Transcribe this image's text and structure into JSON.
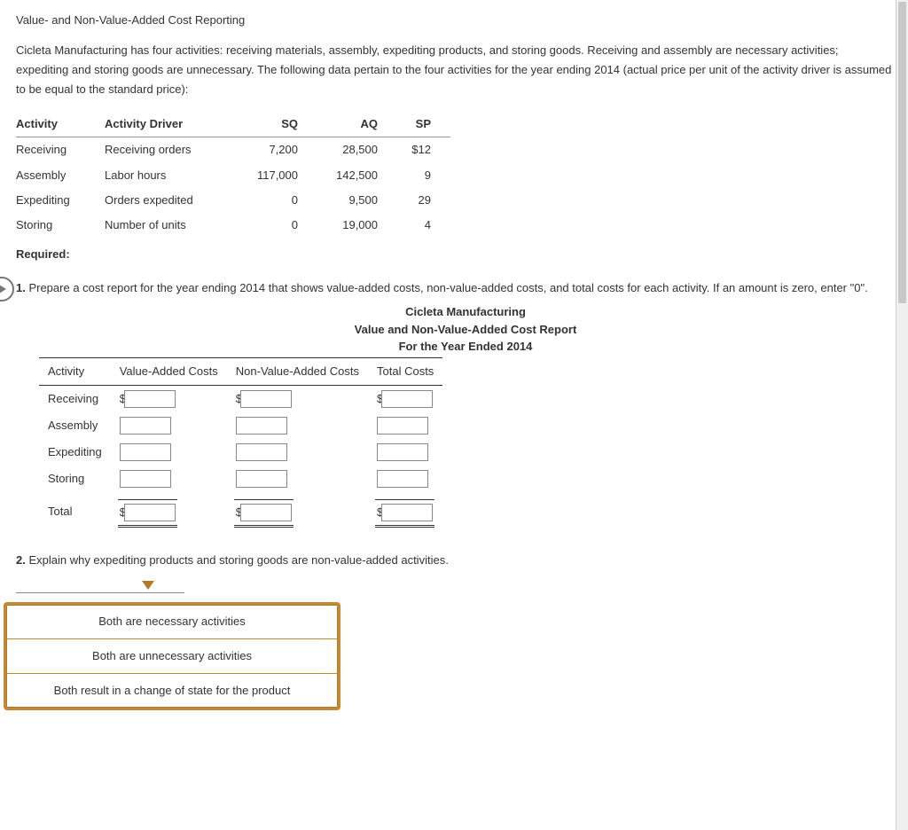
{
  "title": "Value- and Non-Value-Added Cost Reporting",
  "intro": "Cicleta Manufacturing has four activities: receiving materials, assembly, expediting products, and storing goods. Receiving and assembly are necessary activities; expediting and storing goods are unnecessary. The following data pertain to the four activities for the year ending 2014 (actual price per unit of the activity driver is assumed to be equal to the standard price):",
  "table1": {
    "headers": {
      "activity": "Activity",
      "driver": "Activity Driver",
      "sq": "SQ",
      "aq": "AQ",
      "sp": "SP"
    },
    "rows": [
      {
        "activity": "Receiving",
        "driver": "Receiving orders",
        "sq": "7,200",
        "aq": "28,500",
        "sp": "$12"
      },
      {
        "activity": "Assembly",
        "driver": "Labor hours",
        "sq": "117,000",
        "aq": "142,500",
        "sp": "9"
      },
      {
        "activity": "Expediting",
        "driver": "Orders expedited",
        "sq": "0",
        "aq": "9,500",
        "sp": "29"
      },
      {
        "activity": "Storing",
        "driver": "Number of units",
        "sq": "0",
        "aq": "19,000",
        "sp": "4"
      }
    ]
  },
  "required_label": "Required:",
  "q1": {
    "num": "1.",
    "text": " Prepare a cost report for the year ending 2014 that shows value-added costs, non-value-added costs, and total costs for each activity. If an amount is zero, enter \"0\"."
  },
  "report": {
    "company": "Cicleta Manufacturing",
    "title": "Value and Non-Value-Added Cost Report",
    "period": "For the Year Ended 2014",
    "cols": {
      "activity": "Activity",
      "va": "Value-Added Costs",
      "nva": "Non-Value-Added Costs",
      "total": "Total Costs"
    },
    "rows": [
      "Receiving",
      "Assembly",
      "Expediting",
      "Storing"
    ],
    "total_label": "Total"
  },
  "q2": {
    "num": "2.",
    "text": " Explain why expediting products and storing goods are non-value-added activities."
  },
  "dropdown": {
    "options": [
      "Both are necessary activities",
      "Both are unnecessary activities",
      "Both result in a change of state for the product"
    ]
  }
}
